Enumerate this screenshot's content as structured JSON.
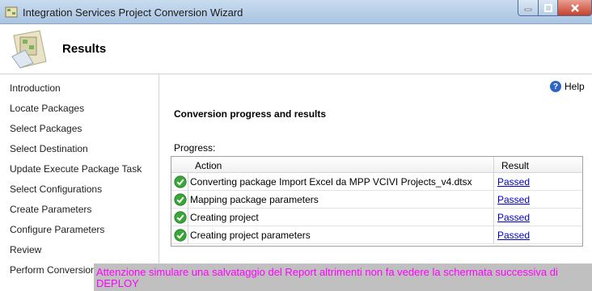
{
  "window": {
    "title": "Integration Services Project Conversion Wizard"
  },
  "header": {
    "title": "Results"
  },
  "sidebar": {
    "items": [
      {
        "label": "Introduction"
      },
      {
        "label": "Locate Packages"
      },
      {
        "label": "Select Packages"
      },
      {
        "label": "Select Destination"
      },
      {
        "label": "Update Execute Package Task"
      },
      {
        "label": "Select Configurations"
      },
      {
        "label": "Create Parameters"
      },
      {
        "label": "Configure Parameters"
      },
      {
        "label": "Review"
      },
      {
        "label": "Perform Conversion"
      }
    ]
  },
  "main": {
    "help_label": "Help",
    "section_title": "Conversion progress and results",
    "progress_label": "Progress:",
    "columns": {
      "action": "Action",
      "result": "Result"
    },
    "rows": [
      {
        "action": "Converting package Import Excel da MPP VCIVI Projects_v4.dtsx",
        "result": "Passed",
        "status_icon": "success-check-icon"
      },
      {
        "action": "Mapping package parameters",
        "result": "Passed",
        "status_icon": "success-check-icon"
      },
      {
        "action": "Creating project",
        "result": "Passed",
        "status_icon": "success-check-icon"
      },
      {
        "action": "Creating project parameters",
        "result": "Passed",
        "status_icon": "success-check-icon"
      }
    ]
  },
  "note": {
    "text": "Attenzione simulare una salvataggio del Report altrimenti non fa vedere la schermata successiva di DEPLOY"
  },
  "colors": {
    "titlebar": "#b9d0e9",
    "link": "#0000cc",
    "note_text": "#ff00ff",
    "note_bg": "#c0c0c0",
    "success": "#3aa63a"
  }
}
